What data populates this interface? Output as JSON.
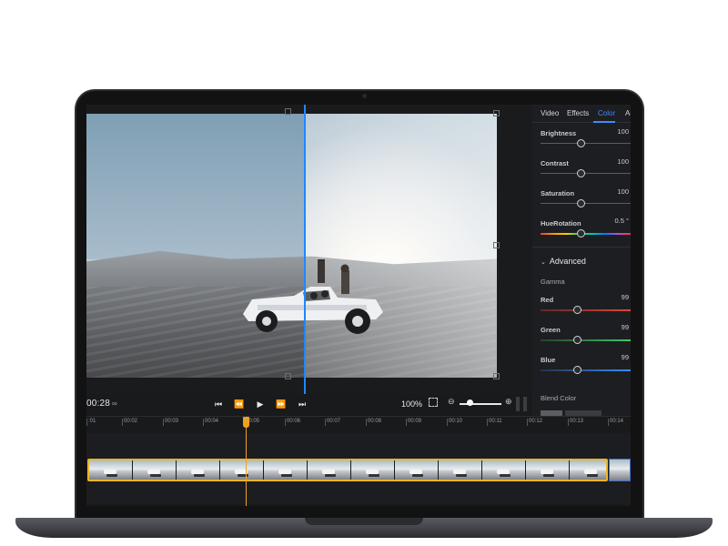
{
  "preview": {
    "timecode": "00:28",
    "timecode_icon": "∞",
    "zoom_percent": "100%"
  },
  "icons": {
    "skip_back": "skip-back-icon",
    "rewind": "rewind-icon",
    "play": "play-icon",
    "fast_forward": "fast-forward-icon",
    "skip_forward": "skip-forward-icon",
    "fit": "fit-screen-icon",
    "zoom_out": "zoom-out-icon",
    "zoom_in": "zoom-in-icon"
  },
  "panel": {
    "tabs": [
      {
        "label": "Video",
        "active": false
      },
      {
        "label": "Effects",
        "active": false
      },
      {
        "label": "Color",
        "active": true
      },
      {
        "label": "Au",
        "active": false
      }
    ],
    "basic": [
      {
        "label": "Brightness",
        "value": "100"
      },
      {
        "label": "Contrast",
        "value": "100"
      },
      {
        "label": "Saturation",
        "value": "100"
      },
      {
        "label": "HueRotation",
        "value": "0.5 °"
      }
    ],
    "advanced": {
      "title": "Advanced",
      "gamma_label": "Gamma",
      "channels": [
        {
          "label": "Red",
          "value": "99"
        },
        {
          "label": "Green",
          "value": "99"
        },
        {
          "label": "Blue",
          "value": "99"
        }
      ],
      "blend_label": "Blend Color"
    }
  },
  "timeline": {
    "ruler": [
      ":01",
      "00:02",
      "00:03",
      "00:04",
      "00:05",
      "00:06",
      "00:07",
      "00:08",
      "00:09",
      "00:10",
      "00:11",
      "00:12",
      "00:13",
      "00:14"
    ],
    "playhead_time": "00:05"
  },
  "colors": {
    "accent": "#3d8bff",
    "split_line": "#1e88ff",
    "playhead": "#f0a020",
    "clip_border": "#f0b429",
    "background": "#191a1c"
  }
}
